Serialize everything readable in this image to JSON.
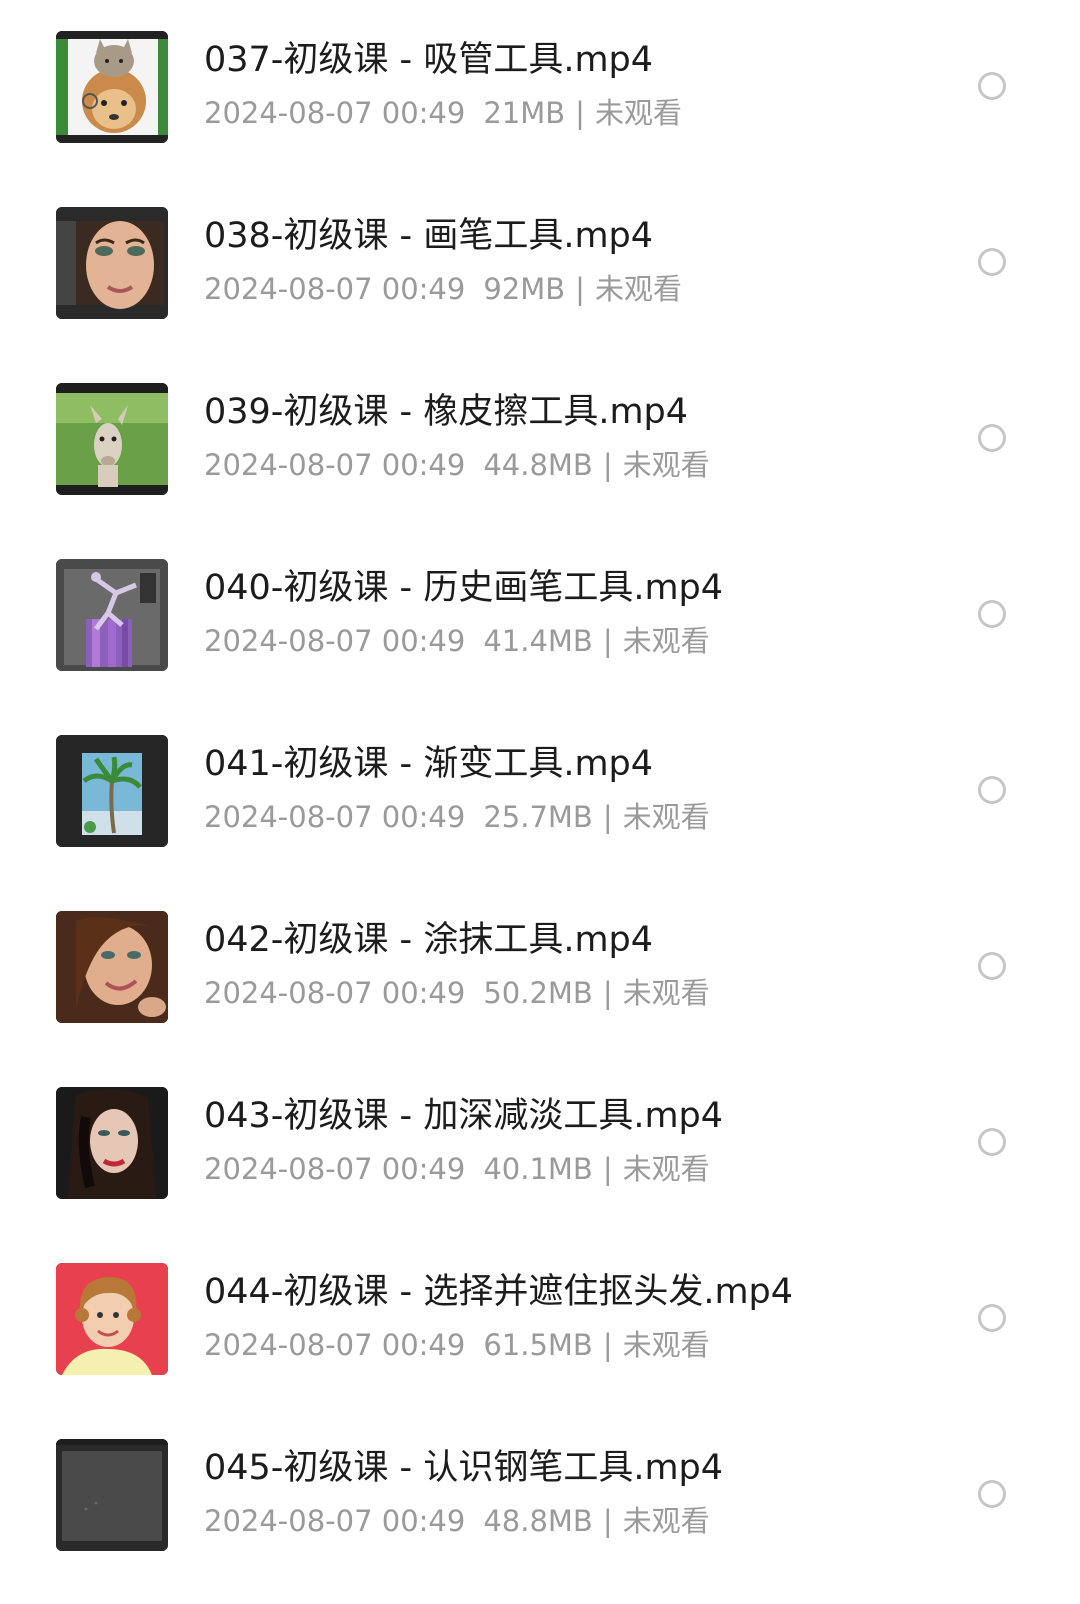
{
  "files": [
    {
      "title": "037-初级课 - 吸管工具.mp4",
      "date": "2024-08-07 00:49",
      "size": "21MB",
      "status": "未观看",
      "thumbnail_icon": "cat-dog-thumbnail-icon"
    },
    {
      "title": "038-初级课 - 画笔工具.mp4",
      "date": "2024-08-07 00:49",
      "size": "92MB",
      "status": "未观看",
      "thumbnail_icon": "woman-portrait-thumbnail-icon"
    },
    {
      "title": "039-初级课 - 橡皮擦工具.mp4",
      "date": "2024-08-07 00:49",
      "size": "44.8MB",
      "status": "未观看",
      "thumbnail_icon": "alpaca-thumbnail-icon"
    },
    {
      "title": "040-初级课 - 历史画笔工具.mp4",
      "date": "2024-08-07 00:49",
      "size": "41.4MB",
      "status": "未观看",
      "thumbnail_icon": "dancer-purple-thumbnail-icon"
    },
    {
      "title": "041-初级课 - 渐变工具.mp4",
      "date": "2024-08-07 00:49",
      "size": "25.7MB",
      "status": "未观看",
      "thumbnail_icon": "palm-tree-thumbnail-icon"
    },
    {
      "title": "042-初级课 - 涂抹工具.mp4",
      "date": "2024-08-07 00:49",
      "size": "50.2MB",
      "status": "未观看",
      "thumbnail_icon": "smiling-woman-thumbnail-icon"
    },
    {
      "title": "043-初级课 - 加深减淡工具.mp4",
      "date": "2024-08-07 00:49",
      "size": "40.1MB",
      "status": "未观看",
      "thumbnail_icon": "dark-hair-woman-thumbnail-icon"
    },
    {
      "title": "044-初级课 - 选择并遮住抠头发.mp4",
      "date": "2024-08-07 00:49",
      "size": "61.5MB",
      "status": "未观看",
      "thumbnail_icon": "child-red-background-thumbnail-icon"
    },
    {
      "title": "045-初级课 - 认识钢笔工具.mp4",
      "date": "2024-08-07 00:49",
      "size": "48.8MB",
      "status": "未观看",
      "thumbnail_icon": "dark-canvas-thumbnail-icon"
    }
  ],
  "colors": {
    "title": "#1c1c1c",
    "meta": "#9a9a9a",
    "radio_border": "#c6c6c6",
    "background": "#ffffff"
  }
}
